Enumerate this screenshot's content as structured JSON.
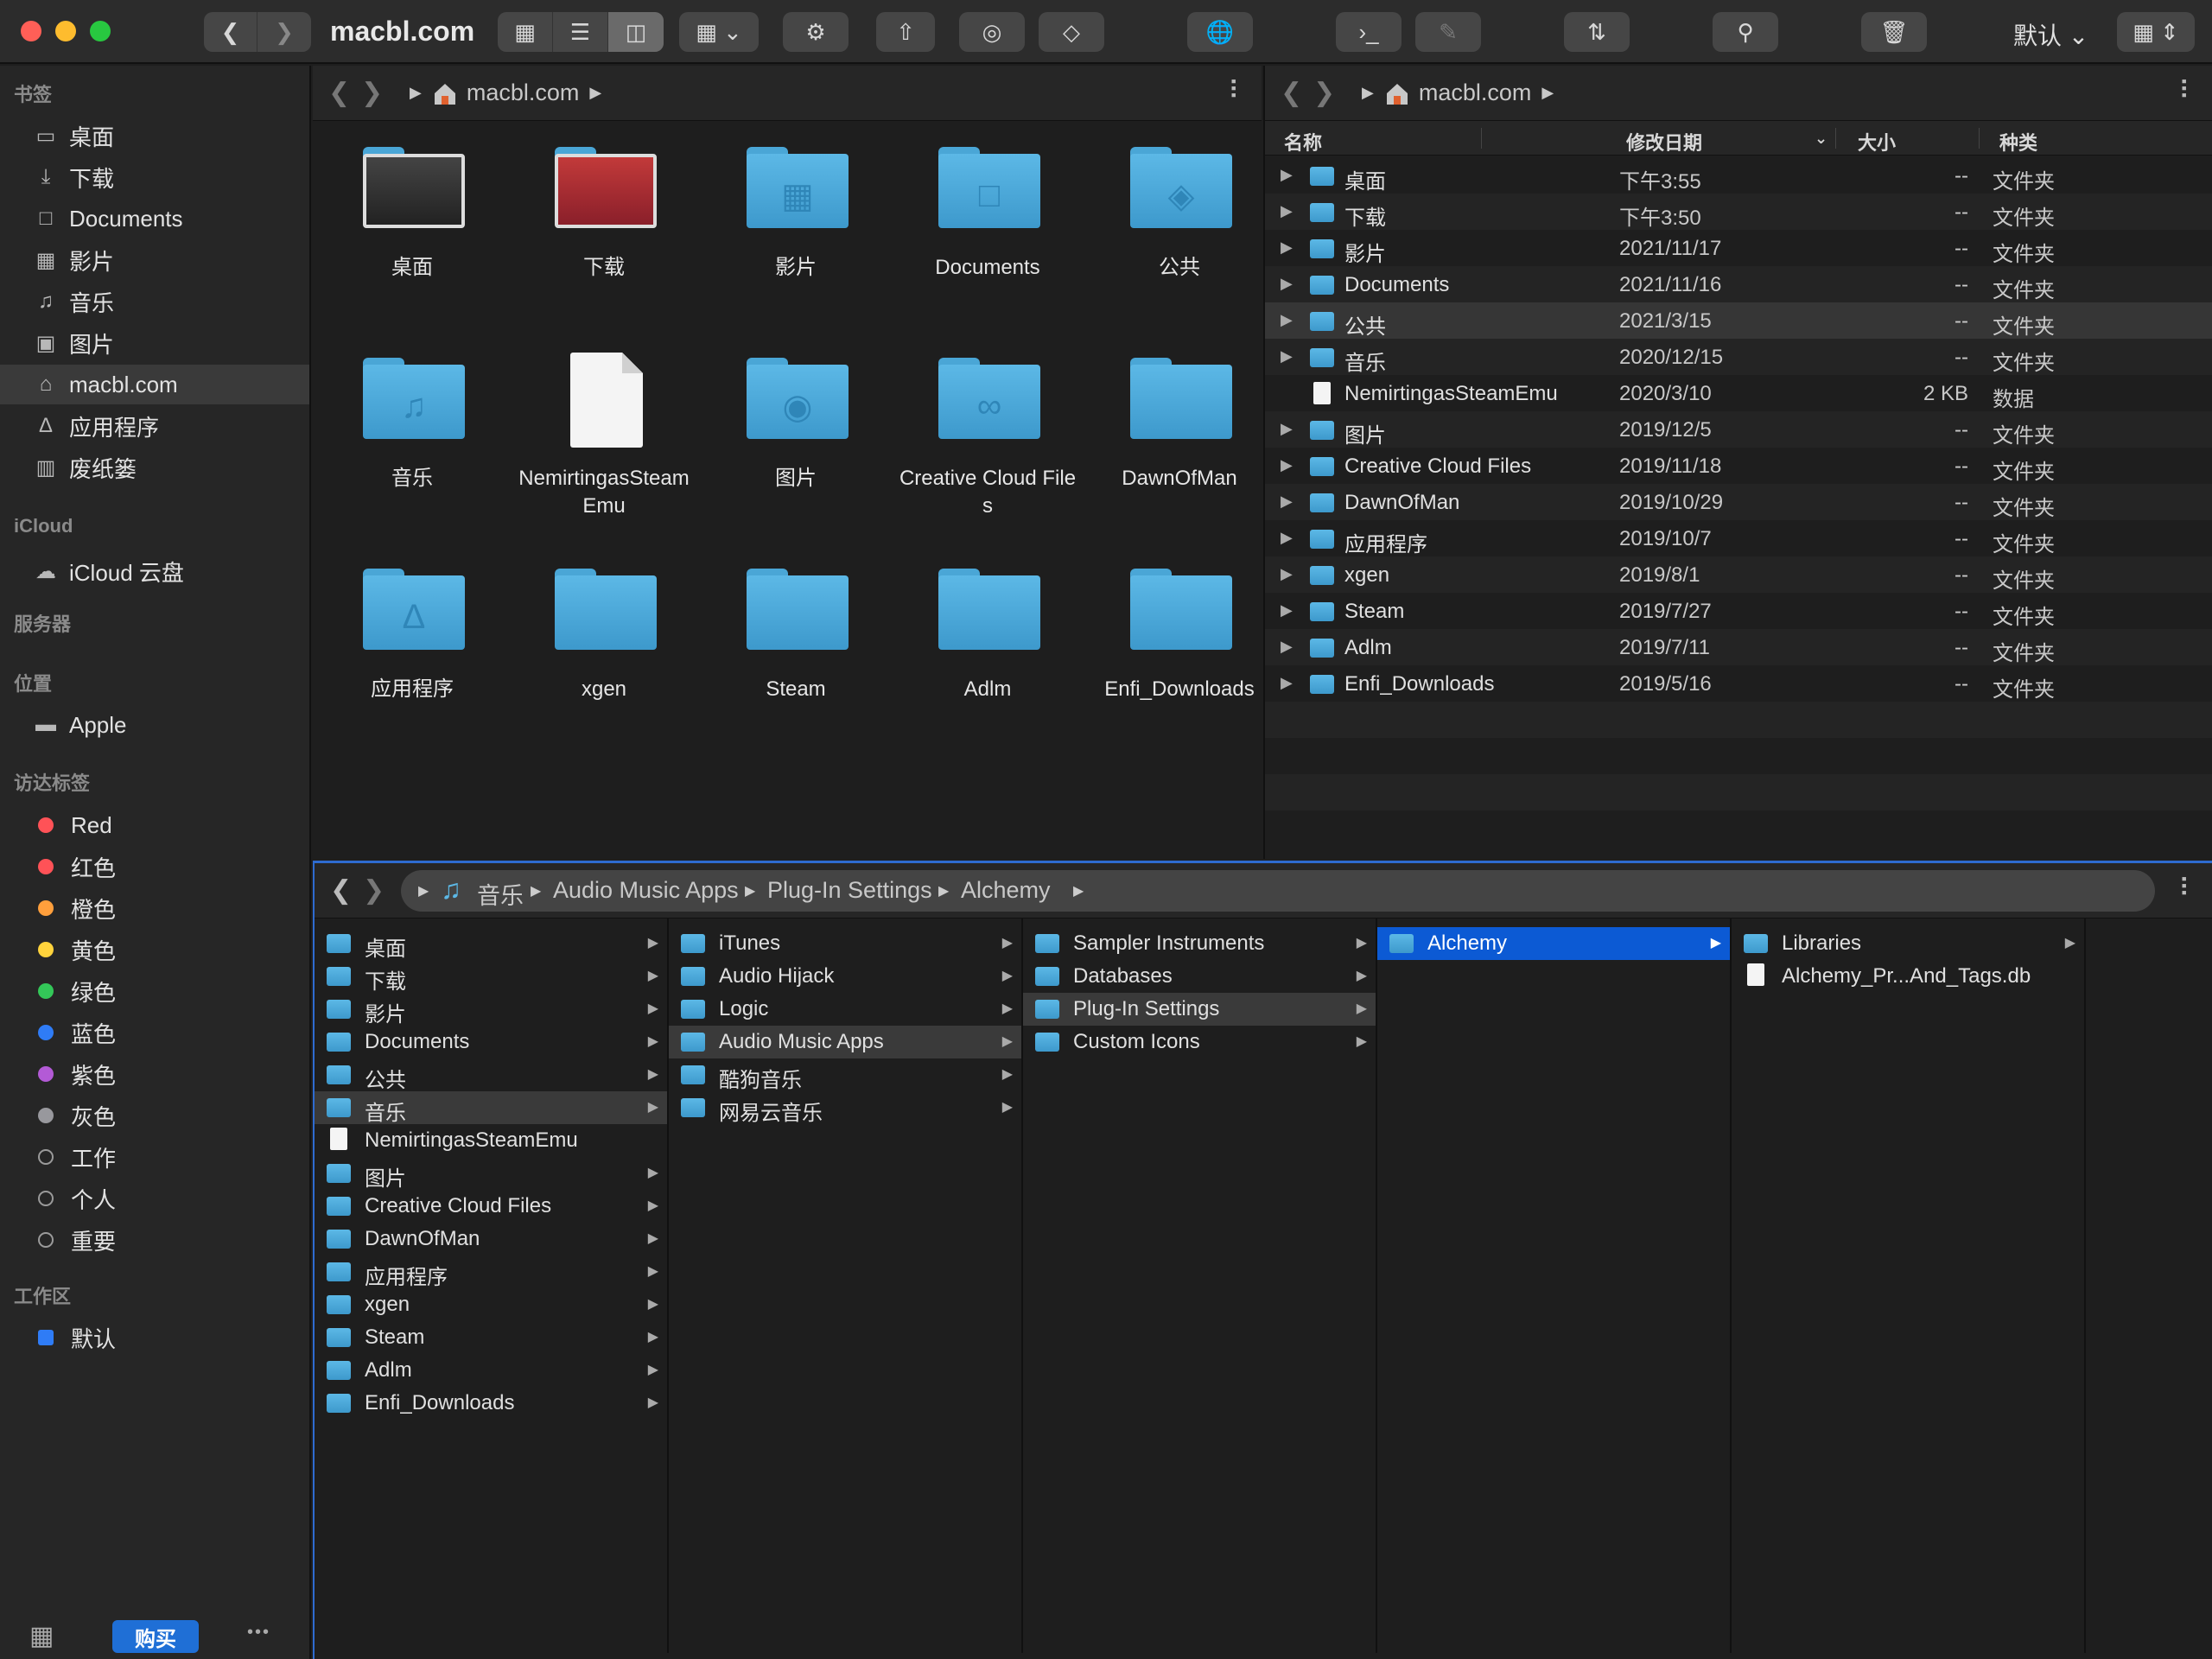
{
  "window": {
    "title": "macbl.com",
    "view_mode": "默认"
  },
  "sidebar": {
    "sections": [
      {
        "title": "书签",
        "items": [
          {
            "label": "桌面",
            "icon": "desktop-icon"
          },
          {
            "label": "下载",
            "icon": "download-icon"
          },
          {
            "label": "Documents",
            "icon": "document-icon"
          },
          {
            "label": "影片",
            "icon": "film-icon"
          },
          {
            "label": "音乐",
            "icon": "music-icon"
          },
          {
            "label": "图片",
            "icon": "photo-icon"
          },
          {
            "label": "macbl.com",
            "icon": "home-icon"
          },
          {
            "label": "应用程序",
            "icon": "apps-icon"
          },
          {
            "label": "废纸篓",
            "icon": "trash-icon"
          }
        ]
      },
      {
        "title": "iCloud",
        "items": [
          {
            "label": "iCloud 云盘",
            "icon": "cloud-icon"
          }
        ]
      },
      {
        "title": "服务器",
        "items": []
      },
      {
        "title": "位置",
        "items": [
          {
            "label": "Apple",
            "icon": "disk-icon"
          }
        ]
      },
      {
        "title": "访达标签",
        "items": [
          {
            "label": "Red",
            "color": "#ff5257"
          },
          {
            "label": "红色",
            "color": "#ff5257"
          },
          {
            "label": "橙色",
            "color": "#ff9f3c"
          },
          {
            "label": "黄色",
            "color": "#ffd33c"
          },
          {
            "label": "绿色",
            "color": "#33c758"
          },
          {
            "label": "蓝色",
            "color": "#2f7cf6"
          },
          {
            "label": "紫色",
            "color": "#b35ad6"
          },
          {
            "label": "灰色",
            "color": "#98989d"
          },
          {
            "label": "工作",
            "color": ""
          },
          {
            "label": "个人",
            "color": ""
          },
          {
            "label": "重要",
            "color": ""
          }
        ]
      },
      {
        "title": "工作区",
        "items": [
          {
            "label": "默认",
            "color": "#2f7cf6"
          }
        ]
      }
    ],
    "buy_label": "购买"
  },
  "icon_pane": {
    "path": "macbl.com",
    "items": [
      "桌面",
      "下载",
      "影片",
      "Documents",
      "公共",
      "音乐",
      "NemirtingasSteamEmu",
      "图片",
      "Creative Cloud Files",
      "DawnOfMan",
      "应用程序",
      "xgen",
      "Steam",
      "Adlm",
      "Enfi_Downloads"
    ]
  },
  "list_pane": {
    "path": "macbl.com",
    "headers": {
      "name": "名称",
      "date": "修改日期",
      "size": "大小",
      "kind": "种类"
    },
    "rows": [
      {
        "name": "桌面",
        "date": "下午3:55",
        "size": "--",
        "kind": "文件夹"
      },
      {
        "name": "下载",
        "date": "下午3:50",
        "size": "--",
        "kind": "文件夹"
      },
      {
        "name": "影片",
        "date": "2021/11/17",
        "size": "--",
        "kind": "文件夹"
      },
      {
        "name": "Documents",
        "date": "2021/11/16",
        "size": "--",
        "kind": "文件夹"
      },
      {
        "name": "公共",
        "date": "2021/3/15",
        "size": "--",
        "kind": "文件夹"
      },
      {
        "name": "音乐",
        "date": "2020/12/15",
        "size": "--",
        "kind": "文件夹"
      },
      {
        "name": "NemirtingasSteamEmu",
        "date": "2020/3/10",
        "size": "2 KB",
        "kind": "数据"
      },
      {
        "name": "图片",
        "date": "2019/12/5",
        "size": "--",
        "kind": "文件夹"
      },
      {
        "name": "Creative Cloud Files",
        "date": "2019/11/18",
        "size": "--",
        "kind": "文件夹"
      },
      {
        "name": "DawnOfMan",
        "date": "2019/10/29",
        "size": "--",
        "kind": "文件夹"
      },
      {
        "name": "应用程序",
        "date": "2019/10/7",
        "size": "--",
        "kind": "文件夹"
      },
      {
        "name": "xgen",
        "date": "2019/8/1",
        "size": "--",
        "kind": "文件夹"
      },
      {
        "name": "Steam",
        "date": "2019/7/27",
        "size": "--",
        "kind": "文件夹"
      },
      {
        "name": "Adlm",
        "date": "2019/7/11",
        "size": "--",
        "kind": "文件夹"
      },
      {
        "name": "Enfi_Downloads",
        "date": "2019/5/16",
        "size": "--",
        "kind": "文件夹"
      }
    ]
  },
  "column_pane": {
    "breadcrumb": [
      "音乐",
      "Audio Music Apps",
      "Plug-In Settings",
      "Alchemy"
    ],
    "columns": [
      [
        "桌面",
        "下载",
        "影片",
        "Documents",
        "公共",
        "音乐",
        "NemirtingasSteamEmu",
        "图片",
        "Creative Cloud Files",
        "DawnOfMan",
        "应用程序",
        "xgen",
        "Steam",
        "Adlm",
        "Enfi_Downloads"
      ],
      [
        "iTunes",
        "Audio Hijack",
        "Logic",
        "Audio Music Apps",
        "酷狗音乐",
        "网易云音乐"
      ],
      [
        "Sampler Instruments",
        "Databases",
        "Plug-In Settings",
        "Custom Icons"
      ],
      [
        "Alchemy"
      ],
      [
        "Libraries",
        "Alchemy_Pr...And_Tags.db"
      ]
    ]
  }
}
